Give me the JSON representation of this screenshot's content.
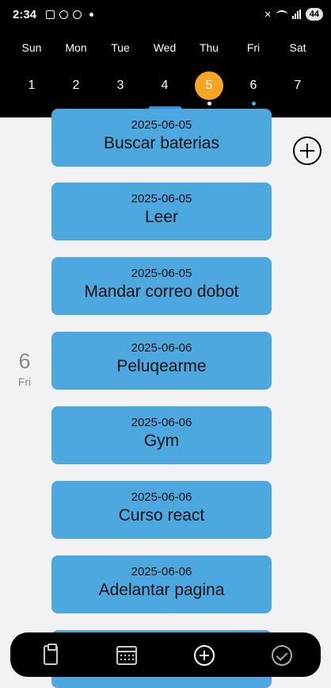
{
  "status_bar": {
    "time": "2:34",
    "battery": "44"
  },
  "week": {
    "days": [
      {
        "name": "Sun",
        "num": "1",
        "active": false,
        "indicator": ""
      },
      {
        "name": "Mon",
        "num": "2",
        "active": false,
        "indicator": ""
      },
      {
        "name": "Tue",
        "num": "3",
        "active": false,
        "indicator": ""
      },
      {
        "name": "Wed",
        "num": "4",
        "active": false,
        "indicator": ""
      },
      {
        "name": "Thu",
        "num": "5",
        "active": true,
        "indicator": "#ffffff"
      },
      {
        "name": "Fri",
        "num": "6",
        "active": false,
        "indicator": "#4aa8e0"
      },
      {
        "name": "Sat",
        "num": "7",
        "active": false,
        "indicator": ""
      }
    ]
  },
  "day_marker": {
    "num": "6",
    "name": "Fri"
  },
  "tasks": [
    {
      "date": "2025-06-05",
      "title": "Buscar baterias"
    },
    {
      "date": "2025-06-05",
      "title": "Leer"
    },
    {
      "date": "2025-06-05",
      "title": "Mandar correo dobot"
    },
    {
      "date": "2025-06-06",
      "title": "Peluqearme"
    },
    {
      "date": "2025-06-06",
      "title": "Gym"
    },
    {
      "date": "2025-06-06",
      "title": "Curso react"
    },
    {
      "date": "2025-06-06",
      "title": "Adelantar pagina"
    },
    {
      "date": "",
      "title": ""
    }
  ],
  "bottom_nav": [
    "clipboard-icon",
    "calendar-icon",
    "add-circle-icon",
    "check-circle-icon"
  ],
  "colors": {
    "accent": "#f5a623",
    "card": "#4ea8e0",
    "header": "#000000",
    "handle": "#2f8ee8"
  }
}
